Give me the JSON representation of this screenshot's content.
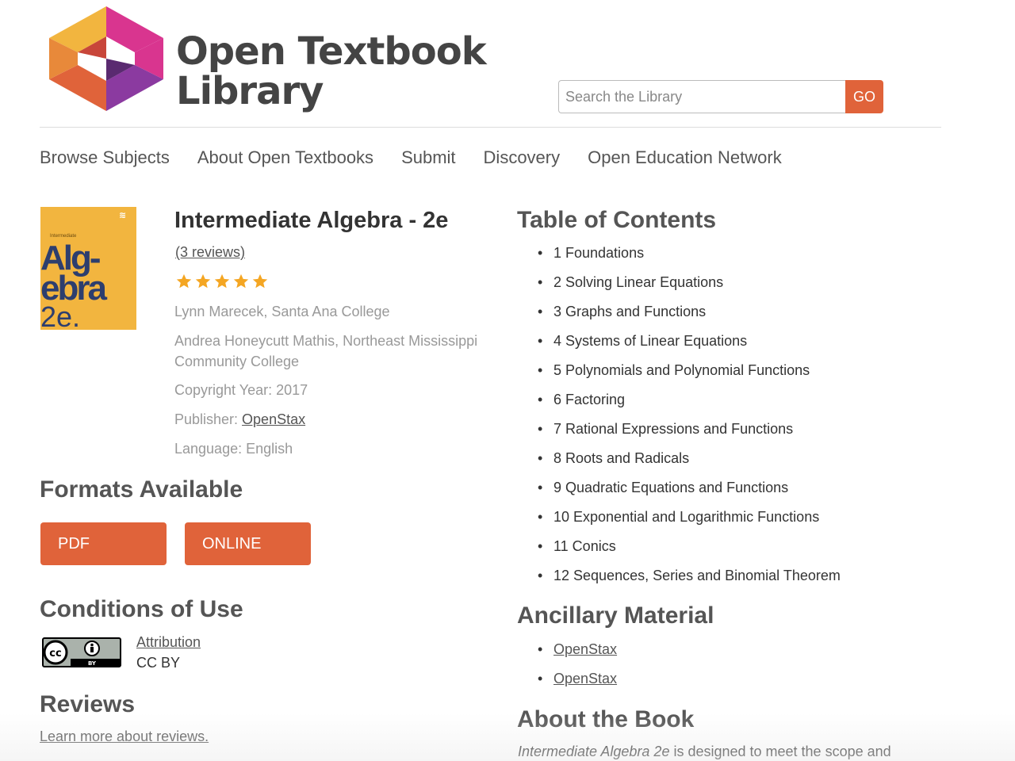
{
  "header": {
    "logo_line1": "Open Textbook",
    "logo_line2": "Library",
    "search_placeholder": "Search the Library",
    "search_button": "GO"
  },
  "nav": {
    "items": [
      {
        "label": "Browse Subjects"
      },
      {
        "label": "About Open Textbooks"
      },
      {
        "label": "Submit"
      },
      {
        "label": "Discovery"
      },
      {
        "label": "Open Education Network"
      }
    ]
  },
  "book": {
    "cover_small": "Intermediate",
    "cover_big_1": "Alg-",
    "cover_big_2": "ebra",
    "cover_edition": "2e.",
    "title": "Intermediate Algebra - 2e",
    "reviews_link": "(3 reviews)",
    "rating": 5,
    "rating_max": 5,
    "author1": "Lynn Marecek, Santa Ana College",
    "author2_line1": "Andrea Honeycutt Mathis, Northeast Mississippi",
    "author2_line2": "Community College",
    "copyright": "Copyright Year: 2017",
    "publisher_label": "Publisher: ",
    "publisher": "OpenStax",
    "language": "Language: English"
  },
  "formats": {
    "heading": "Formats Available",
    "pdf": "PDF",
    "online": "ONLINE"
  },
  "conditions": {
    "heading": "Conditions of Use",
    "license_link": "Attribution",
    "license_code": "CC BY"
  },
  "reviews": {
    "heading": "Reviews",
    "learn_more": "Learn more about reviews."
  },
  "toc": {
    "heading": "Table of Contents",
    "items": [
      "1 Foundations",
      "2 Solving Linear Equations",
      "3 Graphs and Functions",
      "4 Systems of Linear Equations",
      "5 Polynomials and Polynomial Functions",
      "6 Factoring",
      "7 Rational Expressions and Functions",
      "8 Roots and Radicals",
      "9 Quadratic Equations and Functions",
      "10 Exponential and Logarithmic Functions",
      "11 Conics",
      "12 Sequences, Series and Binomial Theorem"
    ]
  },
  "ancillary": {
    "heading": "Ancillary Material",
    "items": [
      "OpenStax",
      "OpenStax"
    ]
  },
  "about": {
    "heading": "About the Book",
    "text_italic": "Intermediate Algebra 2e",
    "text_rest": " is designed to meet the scope and"
  },
  "colors": {
    "accent": "#e0633a",
    "star": "#f4a623",
    "text": "#333333",
    "muted": "#999999"
  }
}
